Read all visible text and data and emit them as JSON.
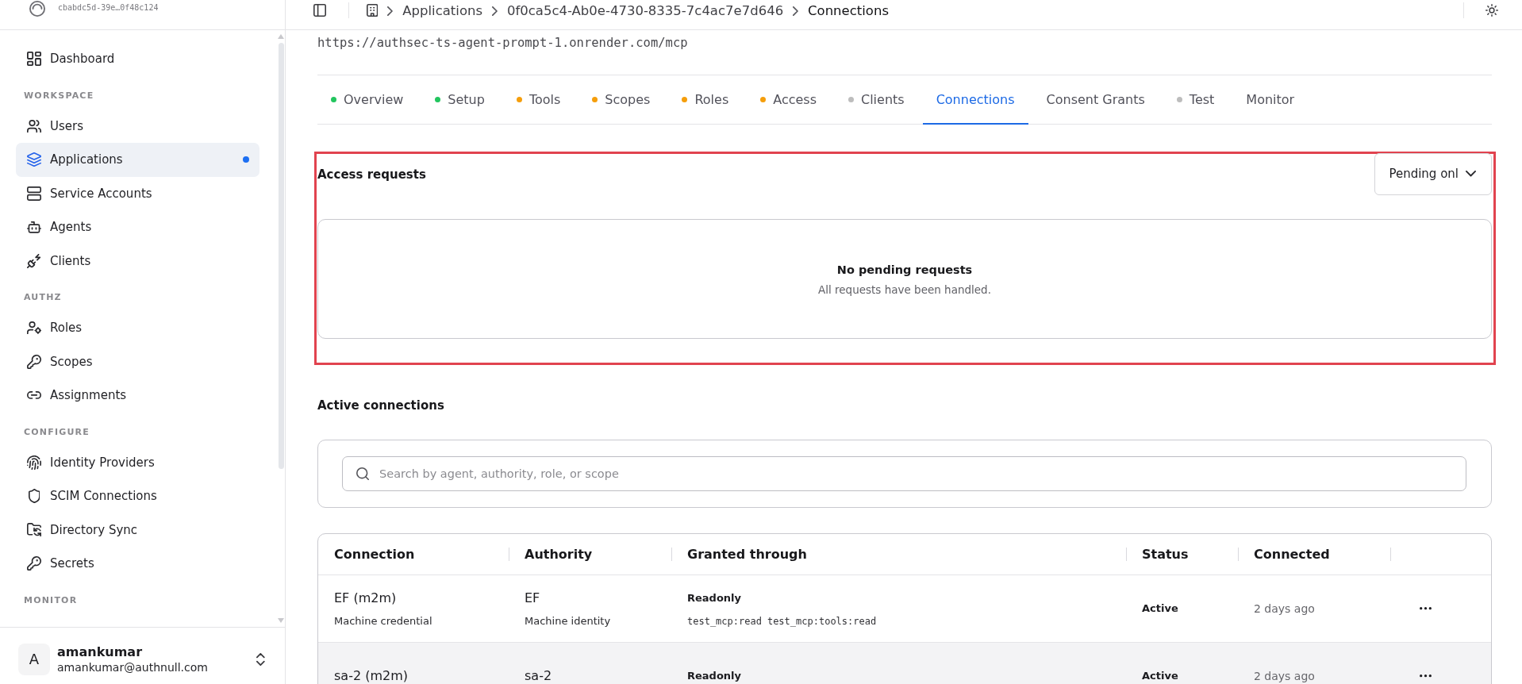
{
  "sidebar": {
    "workspace_id": "cbabdc5d-39e…0f48c124",
    "top_items": [
      {
        "label": "Dashboard",
        "selected": false,
        "indicator": false
      }
    ],
    "sections": [
      {
        "label": "WORKSPACE",
        "items": [
          {
            "label": "Users",
            "selected": false,
            "indicator": false
          },
          {
            "label": "Applications",
            "selected": true,
            "indicator": true
          },
          {
            "label": "Service Accounts",
            "selected": false,
            "indicator": false
          },
          {
            "label": "Agents",
            "selected": false,
            "indicator": false
          },
          {
            "label": "Clients",
            "selected": false,
            "indicator": false
          }
        ]
      },
      {
        "label": "AUTHZ",
        "items": [
          {
            "label": "Roles",
            "selected": false,
            "indicator": false
          },
          {
            "label": "Scopes",
            "selected": false,
            "indicator": false
          },
          {
            "label": "Assignments",
            "selected": false,
            "indicator": false
          }
        ]
      },
      {
        "label": "CONFIGURE",
        "items": [
          {
            "label": "Identity Providers",
            "selected": false,
            "indicator": false
          },
          {
            "label": "SCIM Connections",
            "selected": false,
            "indicator": false
          },
          {
            "label": "Directory Sync",
            "selected": false,
            "indicator": false
          },
          {
            "label": "Secrets",
            "selected": false,
            "indicator": false
          }
        ]
      },
      {
        "label": "MONITOR"
      }
    ],
    "user": {
      "initial": "A",
      "name": "amankumar",
      "email": "amankumar@authnull.com"
    }
  },
  "breadcrumb": [
    "Applications",
    "0f0ca5c4-Ab0e-4730-8335-7c4ac7e7d646",
    "Connections"
  ],
  "url": "https://authsec-ts-agent-prompt-1.onrender.com/mcp",
  "tabs": [
    {
      "label": "Overview",
      "selected": false,
      "color": "#22c55e"
    },
    {
      "label": "Setup",
      "selected": false,
      "color": "#22c55e"
    },
    {
      "label": "Tools",
      "selected": false,
      "color": "#f59e0b"
    },
    {
      "label": "Scopes",
      "selected": false,
      "color": "#f59e0b"
    },
    {
      "label": "Roles",
      "selected": false,
      "color": "#f59e0b"
    },
    {
      "label": "Access",
      "selected": false,
      "color": "#f59e0b"
    },
    {
      "label": "Clients",
      "selected": false,
      "color": "#bdbdbd"
    },
    {
      "label": "Connections",
      "selected": true
    },
    {
      "label": "Consent Grants",
      "selected": false
    },
    {
      "label": "Test",
      "selected": false,
      "color": "#bdbdbd"
    },
    {
      "label": "Monitor",
      "selected": false
    }
  ],
  "access_requests": {
    "title": "Access requests",
    "highlighted": true,
    "filter": "Pending onl",
    "empty_title": "No pending requests",
    "empty_message": "All requests have been handled."
  },
  "active_connections": {
    "title": "Active connections",
    "search": {
      "placeholder": "Search by agent, authority, role, or scope"
    },
    "table": {
      "columns": [
        "Connection",
        "Authority",
        "Granted through",
        "Status",
        "Connected"
      ],
      "rows": [
        {
          "connection": "EF (m2m)",
          "connection_type": "Machine credential",
          "authority": "EF",
          "authority_type": "Machine identity",
          "role": "Readonly",
          "scopes": [
            "test_mcp:read",
            "test_mcp:tools:read"
          ],
          "status": "Active",
          "connected": "2 days ago",
          "highlighted": false
        },
        {
          "connection": "sa-2 (m2m)",
          "authority": "sa-2",
          "role": "Readonly",
          "status": "Active",
          "connected": "2 days ago",
          "highlighted": true
        }
      ]
    }
  }
}
